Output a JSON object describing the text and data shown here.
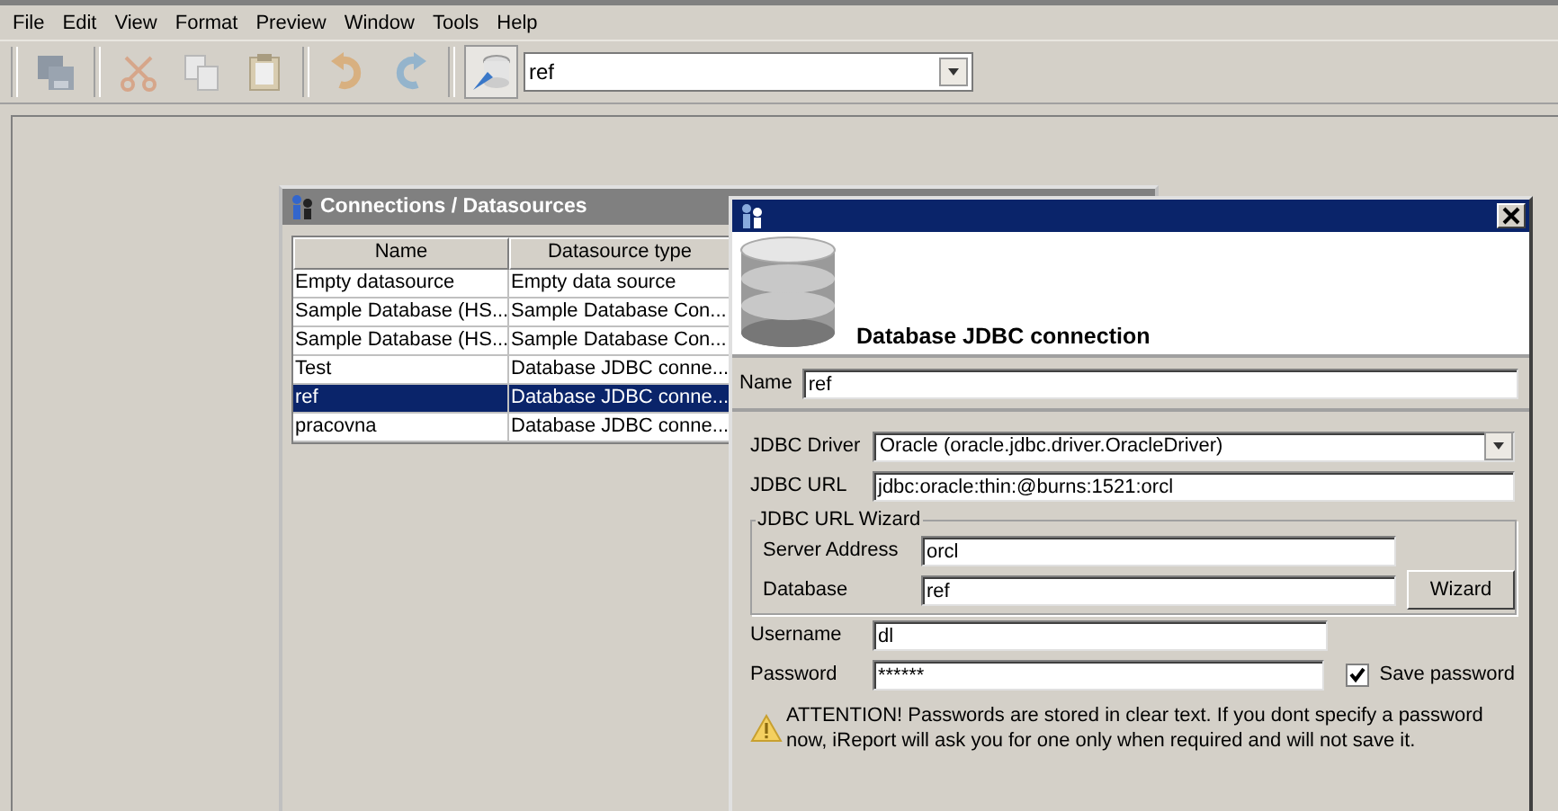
{
  "menu": [
    "File",
    "Edit",
    "View",
    "Format",
    "Preview",
    "Window",
    "Tools",
    "Help"
  ],
  "toolbar": {
    "datasource": {
      "value": "ref"
    }
  },
  "connections_window": {
    "title": "Connections / Datasources",
    "table": {
      "columns": [
        "Name",
        "Datasource type"
      ],
      "rows": [
        {
          "name": "Empty datasource",
          "type": "Empty data source",
          "selected": false
        },
        {
          "name": "Sample Database (HS...",
          "type": "Sample Database Con...",
          "selected": false
        },
        {
          "name": "Sample Database (HS...",
          "type": "Sample Database Con...",
          "selected": false
        },
        {
          "name": "Test",
          "type": "Database JDBC conne...",
          "selected": false
        },
        {
          "name": "ref",
          "type": "Database JDBC conne...",
          "selected": true
        },
        {
          "name": "pracovna",
          "type": "Database JDBC conne...",
          "selected": false
        }
      ]
    }
  },
  "dialog": {
    "header": "Database JDBC connection",
    "name": {
      "label": "Name",
      "value": "ref"
    },
    "jdbc_driver": {
      "label": "JDBC Driver",
      "value": "Oracle (oracle.jdbc.driver.OracleDriver)"
    },
    "jdbc_url": {
      "label": "JDBC URL",
      "value": "jdbc:oracle:thin:@burns:1521:orcl"
    },
    "wizard": {
      "legend": "JDBC URL Wizard",
      "server_address": {
        "label": "Server Address",
        "value": "orcl"
      },
      "database": {
        "label": "Database",
        "value": "ref"
      },
      "button": "Wizard"
    },
    "username": {
      "label": "Username",
      "value": "dl"
    },
    "password": {
      "label": "Password",
      "value": "******"
    },
    "save_password": {
      "label": "Save password",
      "checked": true
    },
    "warning": "ATTENTION! Passwords are stored in clear text. If you dont specify a password now, iReport will ask you for one only when required and will not save it."
  }
}
